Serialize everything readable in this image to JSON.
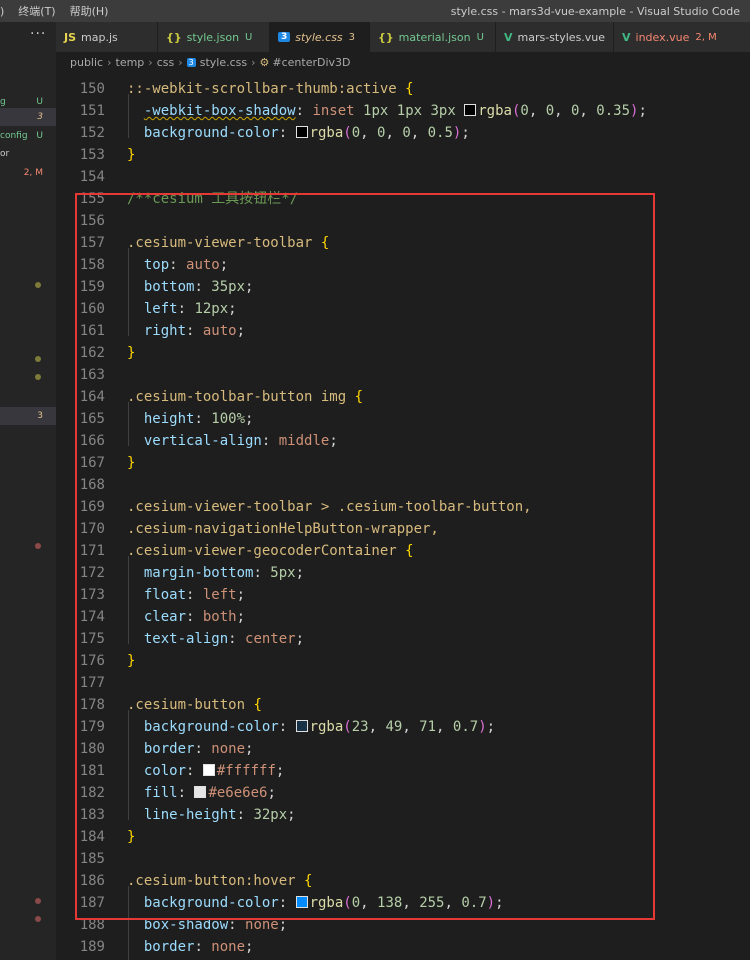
{
  "titlebar": {
    "menu": [
      ")",
      "终端(T)",
      "帮助(H)"
    ],
    "window_title": "style.css - mars3d-vue-example - Visual Studio Code"
  },
  "sidebar": {
    "more_label": "···",
    "rows": [
      {
        "name": "g",
        "badge": "U"
      },
      {
        "name": "",
        "badge": "3"
      },
      {
        "name": "config",
        "badge": "U"
      },
      {
        "name": "or",
        "badge": ""
      },
      {
        "name": "",
        "badge": "2, M"
      },
      {
        "name": "",
        "badge": "3"
      }
    ]
  },
  "tabs": [
    {
      "icon": "JS",
      "label": "map.js",
      "status": "",
      "icon_color": "#e8d44d",
      "label_color": "#cccccc"
    },
    {
      "icon": "{}",
      "label": "style.json",
      "status": "U",
      "icon_color": "#cbcb41",
      "label_color": "#73c991"
    },
    {
      "icon": "3",
      "label": "style.css",
      "status": "3",
      "icon_color": "#42a5f5",
      "label_color": "#e2c08d",
      "active": true
    },
    {
      "icon": "{}",
      "label": "material.json",
      "status": "U",
      "icon_color": "#cbcb41",
      "label_color": "#73c991"
    },
    {
      "icon": "V",
      "label": "mars-styles.vue",
      "status": "",
      "icon_color": "#41b883",
      "label_color": "#cccccc"
    },
    {
      "icon": "V",
      "label": "index.vue",
      "status": "2, M",
      "icon_color": "#41b883",
      "label_color": "#f48771"
    }
  ],
  "breadcrumb": [
    "public",
    "temp",
    "css",
    "style.css",
    "#centerDiv3D"
  ],
  "colors": {
    "accent_red_box": "#e53935",
    "selector": "#d7ba7d",
    "property": "#9cdcfe",
    "value": "#ce9178",
    "number": "#b5cea8"
  },
  "code_lines": [
    {
      "n": "150",
      "t": "::-webkit-scrollbar-thumb:active {"
    },
    {
      "n": "151",
      "t": "  -webkit-box-shadow: inset 1px 1px 3px rgba(0, 0, 0, 0.35);"
    },
    {
      "n": "152",
      "t": "  background-color: rgba(0, 0, 0, 0.5);"
    },
    {
      "n": "153",
      "t": "}"
    },
    {
      "n": "154",
      "t": ""
    },
    {
      "n": "155",
      "t": "/**cesium 工具按钮栏*/"
    },
    {
      "n": "156",
      "t": ""
    },
    {
      "n": "157",
      "t": ".cesium-viewer-toolbar {"
    },
    {
      "n": "158",
      "t": "  top: auto;"
    },
    {
      "n": "159",
      "t": "  bottom: 35px;"
    },
    {
      "n": "160",
      "t": "  left: 12px;"
    },
    {
      "n": "161",
      "t": "  right: auto;"
    },
    {
      "n": "162",
      "t": "}"
    },
    {
      "n": "163",
      "t": ""
    },
    {
      "n": "164",
      "t": ".cesium-toolbar-button img {"
    },
    {
      "n": "165",
      "t": "  height: 100%;"
    },
    {
      "n": "166",
      "t": "  vertical-align: middle;"
    },
    {
      "n": "167",
      "t": "}"
    },
    {
      "n": "168",
      "t": ""
    },
    {
      "n": "169",
      "t": ".cesium-viewer-toolbar > .cesium-toolbar-button,"
    },
    {
      "n": "170",
      "t": ".cesium-navigationHelpButton-wrapper,"
    },
    {
      "n": "171",
      "t": ".cesium-viewer-geocoderContainer {"
    },
    {
      "n": "172",
      "t": "  margin-bottom: 5px;"
    },
    {
      "n": "173",
      "t": "  float: left;"
    },
    {
      "n": "174",
      "t": "  clear: both;"
    },
    {
      "n": "175",
      "t": "  text-align: center;"
    },
    {
      "n": "176",
      "t": "}"
    },
    {
      "n": "177",
      "t": ""
    },
    {
      "n": "178",
      "t": ".cesium-button {"
    },
    {
      "n": "179",
      "t": "  background-color: rgba(23, 49, 71, 0.7);"
    },
    {
      "n": "180",
      "t": "  border: none;"
    },
    {
      "n": "181",
      "t": "  color: #ffffff;"
    },
    {
      "n": "182",
      "t": "  fill: #e6e6e6;"
    },
    {
      "n": "183",
      "t": "  line-height: 32px;"
    },
    {
      "n": "184",
      "t": "}"
    },
    {
      "n": "185",
      "t": ""
    },
    {
      "n": "186",
      "t": ".cesium-button:hover {"
    },
    {
      "n": "187",
      "t": "  background-color: rgba(0, 138, 255, 0.7);"
    },
    {
      "n": "188",
      "t": "  box-shadow: none;"
    },
    {
      "n": "189",
      "t": "  border: none;"
    }
  ]
}
